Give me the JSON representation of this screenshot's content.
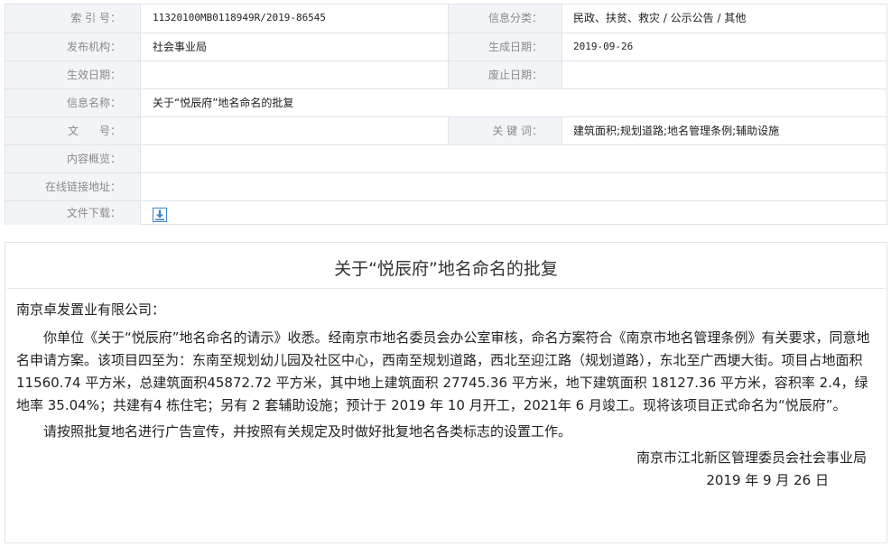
{
  "meta": {
    "index_label": "索 引 号：",
    "index_value": "11320100MB0118949R/2019-86545",
    "category_label": "信息分类：",
    "category_value": "民政、扶贫、救灾 / 公示公告 / 其他",
    "publisher_label": "发布机构：",
    "publisher_value": "社会事业局",
    "generated_label": "生成日期：",
    "generated_value": "2019-09-26",
    "effective_label": "生效日期：",
    "effective_value": "",
    "expire_label": "废止日期：",
    "expire_value": "",
    "name_label": "信息名称：",
    "name_value": "关于“悦辰府”地名命名的批复",
    "docno_label": "文      号：",
    "docno_value": "",
    "keywords_label": "关 键 词：",
    "keywords_value": "建筑面积;规划道路;地名管理条例;辅助设施",
    "summary_label": "内容概览：",
    "summary_value": "",
    "link_label": "在线链接地址：",
    "link_value": "",
    "download_label": "文件下载：",
    "download_icon": "download-icon",
    "download_color": "#3f86c8"
  },
  "article": {
    "title": "关于“悦辰府”地名命名的批复",
    "salutation": "南京卓发置业有限公司：",
    "para1": "你单位《关于“悦辰府”地名命名的请示》收悉。经南京市地名委员会办公室审核，命名方案符合《南京市地名管理条例》有关要求，同意地名申请方案。该项目四至为：东南至规划幼儿园及社区中心，西南至规划道路，西北至迎江路（规划道路），东北至广西埂大街。项目占地面积 11560.74 平方米，总建筑面积45872.72 平方米，其中地上建筑面积 27745.36 平方米，地下建筑面积 18127.36 平方米，容积率 2.4，绿地率 35.04%；共建有4 栋住宅；另有 2 套辅助设施；预计于 2019 年 10 月开工，2021年 6 月竣工。现将该项目正式命名为“悦辰府”。",
    "para2": "请按照批复地名进行广告宣传，并按照有关规定及时做好批复地名各类标志的设置工作。",
    "signer": "南京市江北新区管理委员会社会事业局",
    "date": "2019 年 9 月 26 日"
  }
}
